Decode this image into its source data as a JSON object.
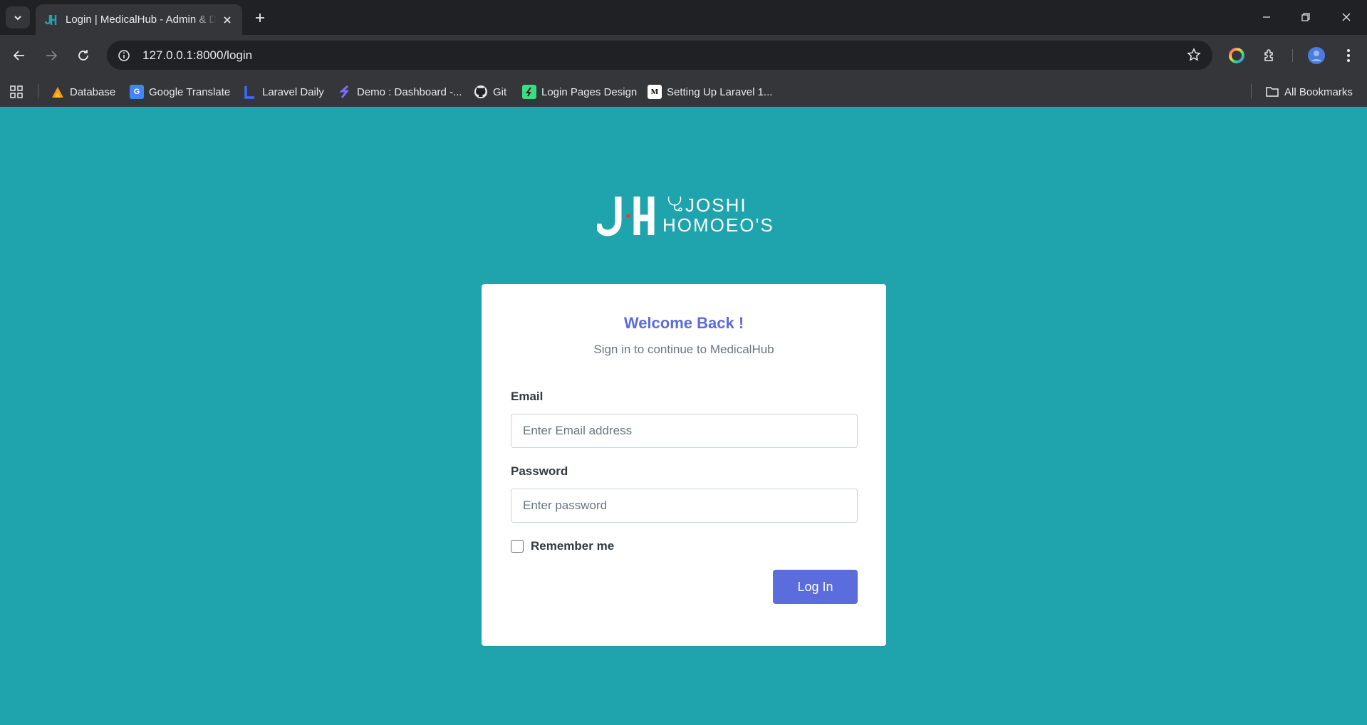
{
  "browser": {
    "tab_title": "Login | MedicalHub - Admin & Dashboard",
    "url": "127.0.0.1:8000/login",
    "bookmarks": [
      {
        "label": "Database",
        "icon": "database-bookmark-icon"
      },
      {
        "label": "Google Translate",
        "icon": "google-translate-icon"
      },
      {
        "label": "Laravel Daily",
        "icon": "laravel-daily-icon"
      },
      {
        "label": "Demo : Dashboard -...",
        "icon": "demo-dashboard-icon"
      },
      {
        "label": "Git",
        "icon": "github-icon"
      },
      {
        "label": "Login Pages Design",
        "icon": "login-pages-icon"
      },
      {
        "label": "Setting Up Laravel 1...",
        "icon": "medium-icon"
      }
    ],
    "all_bookmarks_label": "All Bookmarks",
    "colors": {
      "tabstrip": "#202124",
      "toolbar": "#35363a"
    }
  },
  "logo": {
    "line1": "JOSHI",
    "line2": "HOMOEO'S"
  },
  "login": {
    "title": "Welcome Back !",
    "subtitle": "Sign in to continue to MedicalHub",
    "email_label": "Email",
    "email_placeholder": "Enter Email address",
    "password_label": "Password",
    "password_placeholder": "Enter password",
    "remember_label": "Remember me",
    "submit_label": "Log In"
  },
  "colors": {
    "page_background": "#1fa4ae",
    "accent": "#5b6cdc"
  }
}
